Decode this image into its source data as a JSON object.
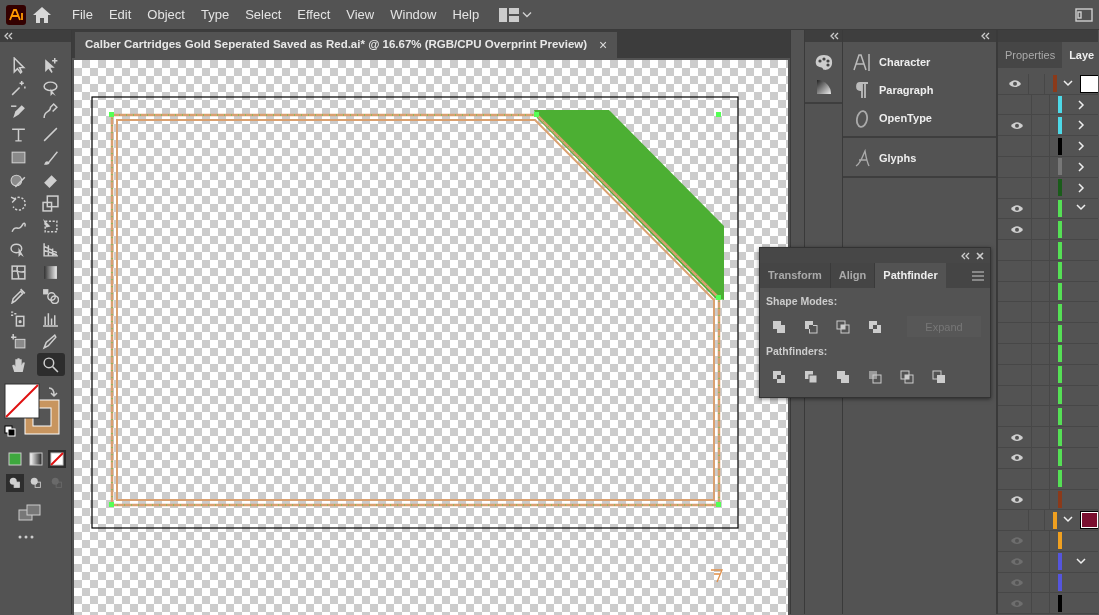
{
  "menu": {
    "items": [
      "File",
      "Edit",
      "Object",
      "Type",
      "Select",
      "Effect",
      "View",
      "Window",
      "Help"
    ]
  },
  "document_tab": {
    "title": "Calber Cartridges Gold Seperated Saved as Red.ai* @ 16.67% (RGB/CPU Overprint Preview)",
    "close": "×"
  },
  "tools": [
    {
      "selected": false
    },
    {
      "selected": false
    },
    {
      "selected": false
    },
    {
      "selected": false
    },
    {
      "selected": false
    },
    {
      "selected": false
    },
    {
      "selected": false
    },
    {
      "selected": false
    },
    {
      "selected": false
    },
    {
      "selected": false
    },
    {
      "selected": false
    },
    {
      "selected": false
    },
    {
      "selected": false
    },
    {
      "selected": false
    },
    {
      "selected": false
    },
    {
      "selected": false
    },
    {
      "selected": false
    },
    {
      "selected": false
    },
    {
      "selected": false
    },
    {
      "selected": false
    },
    {
      "selected": false
    },
    {
      "selected": false
    },
    {
      "selected": false
    },
    {
      "selected": false
    },
    {
      "selected": false
    },
    {
      "selected": false
    },
    {
      "selected": false
    },
    {
      "selected": true
    }
  ],
  "fill_modes": [
    {
      "selected": false
    },
    {
      "selected": false
    },
    {
      "selected": true
    }
  ],
  "draw_modes": [
    {
      "selected": true,
      "disabled": false
    },
    {
      "selected": false,
      "disabled": false
    },
    {
      "selected": false,
      "disabled": true
    }
  ],
  "panel_groups": [
    {
      "items": [
        {
          "label": "Character"
        },
        {
          "label": "Paragraph"
        },
        {
          "label": "OpenType"
        }
      ]
    },
    {
      "items": [
        {
          "label": "Glyphs"
        }
      ]
    }
  ],
  "layers_tabs": [
    {
      "label": "Properties",
      "selected": false
    },
    {
      "label": "Laye",
      "selected": true
    }
  ],
  "layers": [
    {
      "visible": true,
      "dimmed": false,
      "color": "#8b3a1a",
      "expandable": true,
      "expanded": true,
      "thumbnail": {
        "color": "#ffffff"
      }
    },
    {
      "visible": false,
      "dimmed": false,
      "color": "#4dd9e8",
      "expandable": true,
      "expanded": false
    },
    {
      "visible": true,
      "dimmed": false,
      "color": "#4dd9e8",
      "expandable": true,
      "expanded": false
    },
    {
      "visible": false,
      "dimmed": false,
      "color": "#000000",
      "expandable": true,
      "expanded": false
    },
    {
      "visible": false,
      "dimmed": false,
      "color": "#777777",
      "expandable": true,
      "expanded": false
    },
    {
      "visible": false,
      "dimmed": false,
      "color": "#1a5c1a",
      "expandable": true,
      "expanded": false
    },
    {
      "visible": true,
      "dimmed": false,
      "color": "#55e055",
      "expandable": true,
      "expanded": true
    },
    {
      "visible": true,
      "dimmed": false,
      "color": "#55e055",
      "expandable": false,
      "expanded": false
    },
    {
      "visible": false,
      "dimmed": false,
      "color": "#55e055",
      "expandable": false,
      "expanded": false
    },
    {
      "visible": false,
      "dimmed": false,
      "color": "#55e055",
      "expandable": false,
      "expanded": false
    },
    {
      "visible": false,
      "dimmed": false,
      "color": "#55e055",
      "expandable": false,
      "expanded": false
    },
    {
      "visible": false,
      "dimmed": false,
      "color": "#55e055",
      "expandable": false,
      "expanded": false
    },
    {
      "visible": false,
      "dimmed": false,
      "color": "#55e055",
      "expandable": false,
      "expanded": false
    },
    {
      "visible": false,
      "dimmed": false,
      "color": "#55e055",
      "expandable": false,
      "expanded": false
    },
    {
      "visible": false,
      "dimmed": false,
      "color": "#55e055",
      "expandable": false,
      "expanded": false
    },
    {
      "visible": false,
      "dimmed": false,
      "color": "#55e055",
      "expandable": false,
      "expanded": false
    },
    {
      "visible": false,
      "dimmed": false,
      "color": "#55e055",
      "expandable": false,
      "expanded": false
    },
    {
      "visible": true,
      "dimmed": false,
      "color": "#55e055",
      "expandable": false,
      "expanded": false
    },
    {
      "visible": true,
      "dimmed": false,
      "color": "#55e055",
      "expandable": false,
      "expanded": false
    },
    {
      "visible": false,
      "dimmed": false,
      "color": "#55e055",
      "expandable": false,
      "expanded": false
    },
    {
      "visible": true,
      "dimmed": false,
      "color": "#8b3a1a",
      "expandable": false,
      "expanded": false
    },
    {
      "visible": false,
      "dimmed": false,
      "color": "#f0a020",
      "expandable": true,
      "expanded": true,
      "thumbnail": {
        "color": "#7a1030"
      }
    },
    {
      "visible": true,
      "dimmed": true,
      "color": "#f0a020",
      "expandable": false,
      "expanded": false
    },
    {
      "visible": true,
      "dimmed": true,
      "color": "#5555dd",
      "expandable": true,
      "expanded": true
    },
    {
      "visible": true,
      "dimmed": true,
      "color": "#5555dd",
      "expandable": false,
      "expanded": false
    },
    {
      "visible": true,
      "dimmed": true,
      "color": "#000000",
      "expandable": false,
      "expanded": false
    }
  ],
  "pathfinder": {
    "tabs": [
      {
        "label": "Transform",
        "selected": false
      },
      {
        "label": "Align",
        "selected": false
      },
      {
        "label": "Pathfinder",
        "selected": true
      }
    ],
    "shape_modes_label": "Shape Modes:",
    "expand": {
      "label": "Expand",
      "disabled": true
    },
    "pathfinders_label": "Pathfinders:"
  }
}
